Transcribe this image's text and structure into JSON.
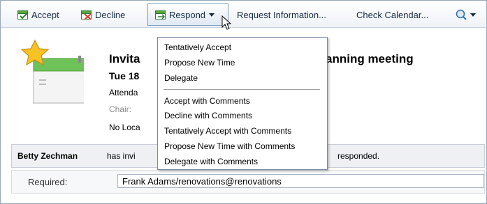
{
  "toolbar": {
    "accept_label": "Accept",
    "decline_label": "Decline",
    "respond_label": "Respond",
    "request_info_label": "Request Information...",
    "check_calendar_label": "Check Calendar..."
  },
  "invitation": {
    "title_start": "Invita",
    "title_end": "anning meeting",
    "date": "Tue 18",
    "attendees": "Attenda",
    "chair": "Chair:",
    "location": "No Loca"
  },
  "status": {
    "name": "Betty Zechman",
    "middle": "has invi",
    "end": "responded."
  },
  "required": {
    "label": "Required:",
    "value": "Frank Adams/renovations@renovations"
  },
  "menu": {
    "group1": [
      "Tentatively Accept",
      "Propose New Time",
      "Delegate"
    ],
    "group2": [
      "Accept with Comments",
      "Decline with Comments",
      "Tentatively Accept with Comments",
      "Propose New Time with Comments",
      "Delegate with Comments"
    ]
  },
  "colors": {
    "accent_green": "#5aa63a",
    "star_yellow": "#f6c324"
  }
}
